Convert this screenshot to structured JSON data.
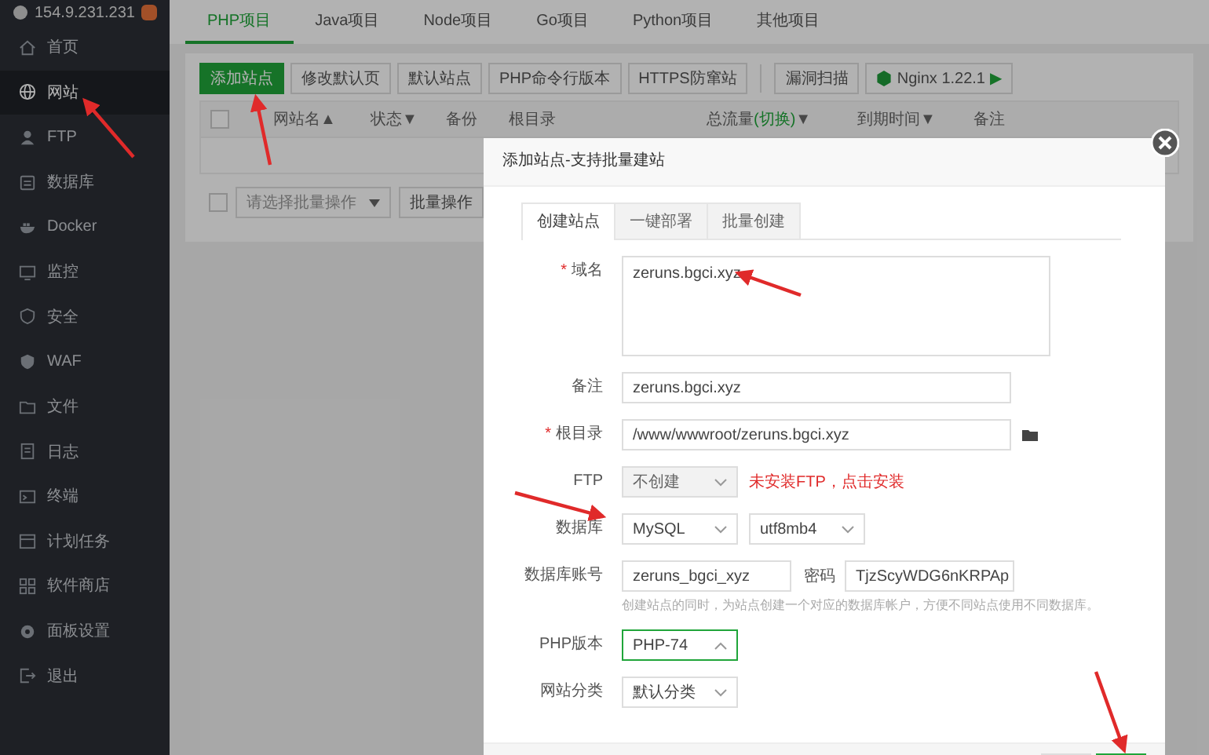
{
  "sidebar": {
    "server": "154.9.231.231",
    "items": [
      {
        "label": "首页",
        "selected": false
      },
      {
        "label": "网站",
        "selected": true
      },
      {
        "label": "FTP",
        "selected": false
      },
      {
        "label": "数据库",
        "selected": false
      },
      {
        "label": "Docker",
        "selected": false
      },
      {
        "label": "监控",
        "selected": false
      },
      {
        "label": "安全",
        "selected": false
      },
      {
        "label": "WAF",
        "selected": false
      },
      {
        "label": "文件",
        "selected": false
      },
      {
        "label": "日志",
        "selected": false
      },
      {
        "label": "终端",
        "selected": false
      },
      {
        "label": "计划任务",
        "selected": false
      },
      {
        "label": "软件商店",
        "selected": false
      },
      {
        "label": "面板设置",
        "selected": false
      },
      {
        "label": "退出",
        "selected": false
      }
    ]
  },
  "project_tabs": [
    {
      "label": "PHP项目",
      "selected": true
    },
    {
      "label": "Java项目",
      "selected": false
    },
    {
      "label": "Node项目",
      "selected": false
    },
    {
      "label": "Go项目",
      "selected": false
    },
    {
      "label": "Python项目",
      "selected": false
    },
    {
      "label": "其他项目",
      "selected": false
    }
  ],
  "toolbar": [
    {
      "label": "添加站点",
      "kind": "primary"
    },
    {
      "label": "修改默认页",
      "kind": "plain"
    },
    {
      "label": "默认站点",
      "kind": "plain"
    },
    {
      "label": "PHP命令行版本",
      "kind": "plain"
    },
    {
      "label": "HTTPS防窜站",
      "kind": "plain"
    },
    {
      "kind": "divider"
    },
    {
      "label": "漏洞扫描",
      "kind": "plain"
    },
    {
      "label": "Nginx 1.22.1",
      "kind": "server",
      "arrow": "▶"
    }
  ],
  "table": {
    "select_all": {
      "checked": false
    },
    "columns": [
      {
        "label": "网站名",
        "sort": "▲"
      },
      {
        "label": "状态",
        "sort": "▼"
      },
      {
        "label": "备份"
      },
      {
        "label": "根目录"
      },
      {
        "label": "总流量",
        "link": "(切换)",
        "sort": "▼"
      },
      {
        "label": "到期时间",
        "sort": "▼"
      },
      {
        "label": "备注"
      }
    ],
    "batch": {
      "checked": false,
      "placeholder": "请选择批量操作",
      "button": "批量操作"
    }
  },
  "dialog": {
    "title": "添加站点-支持批量建站",
    "tabs": [
      {
        "label": "创建站点",
        "selected": true
      },
      {
        "label": "一键部署",
        "selected": false
      },
      {
        "label": "批量创建",
        "selected": false
      }
    ],
    "rows": [
      {
        "label": "域名",
        "required_mark": "*",
        "fields": [
          {
            "kind": "textarea",
            "value": "zeruns.bgci.xyz"
          }
        ]
      },
      {
        "label": "备注",
        "fields": [
          {
            "kind": "input",
            "value": "zeruns.bgci.xyz"
          }
        ]
      },
      {
        "label": "根目录",
        "required_mark": "*",
        "fields": [
          {
            "kind": "path",
            "value": "/www/wwwroot/zeruns.bgci.xyz"
          }
        ]
      },
      {
        "label": "FTP",
        "fields": [
          {
            "kind": "select",
            "value": "不创建",
            "disabled": true,
            "open": false
          }
        ],
        "warning": "未安装FTP，点击安装"
      },
      {
        "label": "数据库",
        "fields": [
          {
            "kind": "select",
            "value": "MySQL",
            "disabled": false,
            "open": false
          },
          {
            "kind": "select",
            "value": "utf8mb4",
            "disabled": false,
            "open": false
          }
        ]
      },
      {
        "label": "数据库账号",
        "fields": [
          {
            "kind": "input-short",
            "value": "zeruns_bgci_xyz"
          },
          {
            "kind": "label",
            "value": "密码"
          },
          {
            "kind": "input-short",
            "value": "TjzScyWDG6nKRPAp"
          }
        ],
        "hint": "创建站点的同时，为站点创建一个对应的数据库帐户，方便不同站点使用不同数据库。"
      },
      {
        "label": "PHP版本",
        "fields": [
          {
            "kind": "select",
            "value": "PHP-74",
            "disabled": false,
            "open": true
          }
        ]
      },
      {
        "label": "网站分类",
        "fields": [
          {
            "kind": "select",
            "value": "默认分类",
            "disabled": false,
            "open": false
          }
        ]
      }
    ]
  }
}
